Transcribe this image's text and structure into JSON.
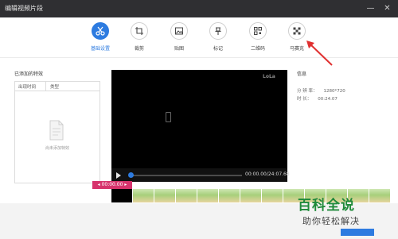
{
  "window": {
    "title": "编辑视频片段",
    "min_glyph": "—",
    "close_glyph": "✕"
  },
  "toolbar": {
    "items": [
      {
        "label": "基础设置",
        "icon": "scissors-icon",
        "active": true
      },
      {
        "label": "裁剪",
        "icon": "crop-icon",
        "active": false
      },
      {
        "label": "贴图",
        "icon": "image-icon",
        "active": false
      },
      {
        "label": "标记",
        "icon": "pin-icon",
        "active": false
      },
      {
        "label": "二维码",
        "icon": "qrcode-icon",
        "active": false
      },
      {
        "label": "马赛克",
        "icon": "mosaic-icon",
        "active": false
      }
    ],
    "accent": "#2d7be0"
  },
  "effects": {
    "title": "已添加的特效",
    "columns": [
      "出现时间",
      "类型"
    ],
    "empty_text": "尚未添加特效"
  },
  "player": {
    "watermark": "LoLa",
    "time": "00:00.00/24:07.68",
    "cursor_time": "00:00.00",
    "progress": 0
  },
  "info": {
    "title": "信息",
    "resolution_label": "分 辨 率：",
    "resolution": "1280*720",
    "duration_label": "时 长：",
    "duration": "00:24.07"
  },
  "watermark_brand": {
    "main": "百科全说",
    "sub": "助你轻松解决",
    "color": "#1f8a3a"
  },
  "colors": {
    "titlebar": "#2f2f32",
    "badge": "#d6336c",
    "video_bg": "#000000"
  }
}
